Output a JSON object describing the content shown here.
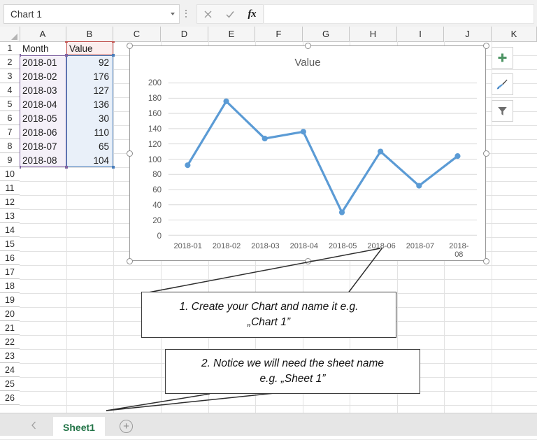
{
  "app": "excel",
  "name_box": {
    "value": "Chart 1",
    "dropdown_icon": "chevron-down-icon"
  },
  "formula_bar": {
    "cancel_icon": "close-icon",
    "confirm_icon": "check-icon",
    "function_icon": "fx-icon",
    "value": "",
    "placeholder": ""
  },
  "grid": {
    "columns": [
      "A",
      "B",
      "C",
      "D",
      "E",
      "F",
      "G",
      "H",
      "I",
      "J",
      "K"
    ],
    "rows": [
      1,
      2,
      3,
      4,
      5,
      6,
      7,
      8,
      9,
      10,
      11,
      12,
      13,
      14,
      15,
      16,
      17,
      18,
      19,
      20,
      21,
      22,
      23,
      24,
      25,
      26
    ],
    "headers": {
      "a": "Month",
      "b": "Value"
    },
    "data": [
      {
        "month": "2018-01",
        "value": "92"
      },
      {
        "month": "2018-02",
        "value": "176"
      },
      {
        "month": "2018-03",
        "value": "127"
      },
      {
        "month": "2018-04",
        "value": "136"
      },
      {
        "month": "2018-05",
        "value": "30"
      },
      {
        "month": "2018-06",
        "value": "110"
      },
      {
        "month": "2018-07",
        "value": "65"
      },
      {
        "month": "2018-08",
        "value": "104"
      }
    ]
  },
  "chart": {
    "name": "Chart 1",
    "side_buttons": [
      {
        "icon": "plus-icon",
        "name": "chart-elements-button"
      },
      {
        "icon": "paintbrush-icon",
        "name": "chart-styles-button"
      },
      {
        "icon": "funnel-icon",
        "name": "chart-filters-button"
      }
    ]
  },
  "chart_data": {
    "type": "line",
    "title": "Value",
    "xlabel": "",
    "ylabel": "",
    "categories": [
      "2018-01",
      "2018-02",
      "2018-03",
      "2018-04",
      "2018-05",
      "2018-06",
      "2018-07",
      "2018-08"
    ],
    "series": [
      {
        "name": "Value",
        "values": [
          92,
          176,
          127,
          136,
          30,
          110,
          65,
          104
        ],
        "color": "#5b9bd5"
      }
    ],
    "ylim": [
      0,
      200
    ],
    "yticks": [
      0,
      20,
      40,
      60,
      80,
      100,
      120,
      140,
      160,
      180,
      200
    ],
    "grid": true,
    "legend": "none",
    "markers": true
  },
  "callouts": [
    {
      "line1": "1. Create your Chart and name it e.g.",
      "line2": "„Chart 1”"
    },
    {
      "line1": "2. Notice we will need the sheet name",
      "line2": "e.g. „Sheet 1”"
    }
  ],
  "tabbar": {
    "prev_icon": "chevron-left-icon",
    "next_icon": "chevron-right-icon",
    "active_sheet": "Sheet1",
    "add_sheet_icon": "plus-circle-icon",
    "add_sheet_label": "+"
  },
  "colors": {
    "line": "#5b9bd5",
    "sheet_tab": "#217346",
    "range_category": "#8064a2",
    "range_value": "#4a7ebb",
    "range_header": "#c0504d"
  }
}
